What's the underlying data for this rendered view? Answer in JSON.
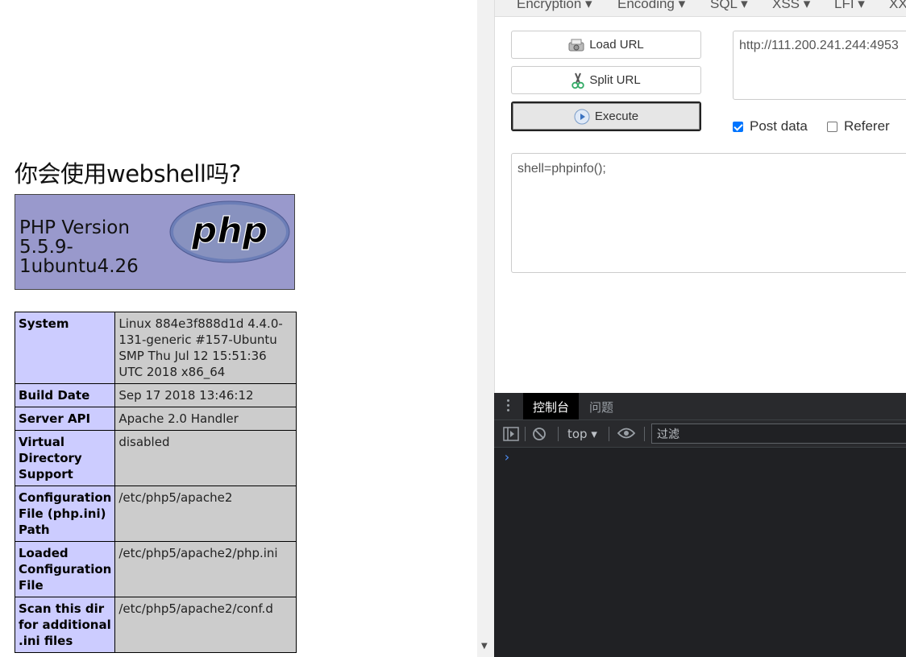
{
  "page": {
    "heading": "你会使用webshell吗?",
    "php_version": "PHP Version 5.5.9-1ubuntu4.26",
    "logo_text": "php",
    "rows": [
      {
        "key": "System",
        "value": "Linux 884e3f888d1d 4.4.0-131-generic #157-Ubuntu SMP Thu Jul 12 15:51:36 UTC 2018 x86_64"
      },
      {
        "key": "Build Date",
        "value": "Sep 17 2018 13:46:12"
      },
      {
        "key": "Server API",
        "value": "Apache 2.0 Handler"
      },
      {
        "key": "Virtual Directory Support",
        "value": "disabled"
      },
      {
        "key": "Configuration File (php.ini) Path",
        "value": "/etc/php5/apache2"
      },
      {
        "key": "Loaded Configuration File",
        "value": "/etc/php5/apache2/php.ini"
      },
      {
        "key": "Scan this dir for additional .ini files",
        "value": "/etc/php5/apache2/conf.d"
      }
    ]
  },
  "hackbar": {
    "menu": [
      "Encryption",
      "Encoding",
      "SQL",
      "XSS",
      "LFI",
      "XX"
    ],
    "load_url": "Load URL",
    "split_url": "Split URL",
    "execute": "Execute",
    "url_value": "http://111.200.241.244:4953",
    "post_data_label": "Post data",
    "post_data_checked": true,
    "referer_label": "Referer",
    "referer_checked": false,
    "post_body": "shell=phpinfo();"
  },
  "devtools": {
    "tab_console": "控制台",
    "tab_issues": "问题",
    "context": "top",
    "filter_placeholder": "过滤",
    "prompt_symbol": "›"
  },
  "colors": {
    "php_header_bg": "#9999cc",
    "key_cell_bg": "#ccccff",
    "value_cell_bg": "#cccccc",
    "devtools_bg": "#202124",
    "checkbox_accent": "#0075ff"
  }
}
